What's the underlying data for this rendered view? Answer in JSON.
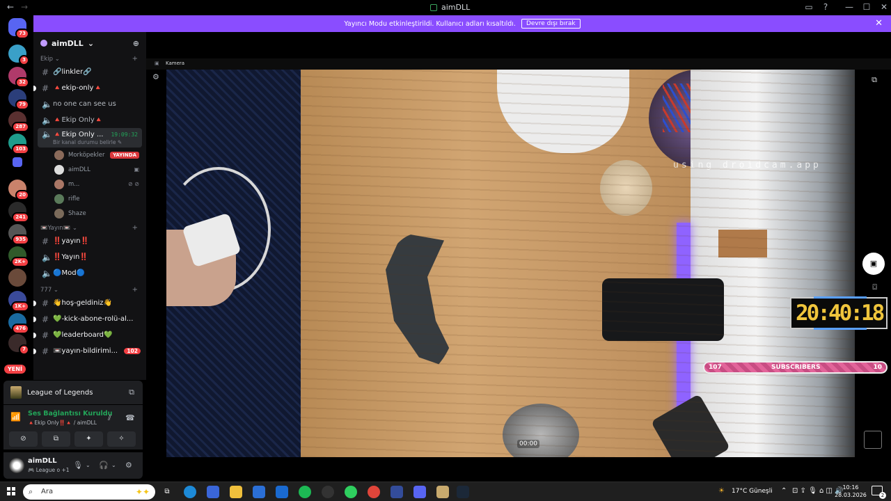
{
  "window": {
    "title": "aimDLL",
    "nav_back": "←",
    "nav_forward": "→",
    "controls": [
      "▭",
      "?",
      "—",
      "☐",
      "✕"
    ]
  },
  "notice": {
    "text": "Yayıncı Modu etkinleştirildi. Kullanıcı adları kısaltıldı.",
    "button": "Devre dışı bırak",
    "close": "✕"
  },
  "rail": {
    "home_badge": "73",
    "servers": [
      {
        "badge": "3",
        "color": "#3aa0c8"
      },
      {
        "badge": "32",
        "color": "#b03a6a"
      },
      {
        "badge": "79",
        "color": "#2b3e7a"
      },
      {
        "badge": "287",
        "color": "#5a3030"
      },
      {
        "badge": "103",
        "color": "#1f9c8c"
      },
      {
        "badge": "",
        "color": "#5865f2"
      },
      {
        "badge": "20",
        "color": "#c9826b"
      },
      {
        "badge": "241",
        "color": "#2a2a2a"
      },
      {
        "badge": "935",
        "color": "#555555"
      },
      {
        "badge": "2K+",
        "color": "#2f5a2a"
      },
      {
        "badge": "",
        "color": "#6a4a3a"
      },
      {
        "badge": "1K+",
        "color": "#3a4a9a"
      },
      {
        "badge": "476",
        "color": "#1a6aa0"
      },
      {
        "badge": "7",
        "color": "#3a2a2a"
      }
    ],
    "new_label": "YENİ"
  },
  "sidebar": {
    "server_name": "aimDLL",
    "add_member_icon": "⊕",
    "categories": [
      {
        "name": "Ekip",
        "channels": [
          {
            "type": "text",
            "name": "🔗linkler🔗"
          },
          {
            "type": "text",
            "name": "🔺ekip-only🔺"
          },
          {
            "type": "voice",
            "name": "no one can see us"
          },
          {
            "type": "voice",
            "name": "🔺Ekip Only🔺"
          }
        ]
      }
    ],
    "active_channel": {
      "name": "🔺Ekip Only ...",
      "time": "19:09:32",
      "status": "Bir kanal durumu belirle ✎"
    },
    "members": [
      {
        "name": "Morköpekler",
        "live": "YAYINDA",
        "color": "#8a6a5a"
      },
      {
        "name": "aimDLL",
        "icon": "▣",
        "color": "#dddddd"
      },
      {
        "name": "m...",
        "icon": "⊘ ⊘",
        "color": "#aa7766"
      },
      {
        "name": "rifle",
        "color": "#5a7a5a"
      },
      {
        "name": "Shaze",
        "color": "#7a6a5a"
      }
    ],
    "category2": {
      "name": "📼Yayın📼",
      "channels": [
        {
          "type": "text",
          "name": "‼️yayın‼️"
        },
        {
          "type": "voice",
          "name": "‼️Yayın‼️"
        },
        {
          "type": "voice",
          "name": "🔵Mod🔵"
        }
      ]
    },
    "category3": {
      "name": "777",
      "channels": [
        {
          "type": "text",
          "name": "👋hoş-geldiniz👋"
        },
        {
          "type": "text",
          "name": "💚-kick-abone-rolü-al..."
        },
        {
          "type": "text",
          "name": "💚leaderboard💚"
        },
        {
          "type": "text",
          "name": "📼yayın-bildirimi...",
          "badge": "102"
        }
      ]
    }
  },
  "game_panel": {
    "name": "League of Legends"
  },
  "voice_panel": {
    "status": "Ses Bağlantısı Kuruldu",
    "location": "🔺Ekip Only‼️🔺 / aimDLL"
  },
  "user_panel": {
    "name": "aimDLL",
    "status": "🎮 League o +1"
  },
  "stream": {
    "camera_title": "Kamera",
    "watermark": "using droidcam.app",
    "video_time": "00:00",
    "overlay_clock": "20:40:18",
    "subs_left": "107",
    "subs_label": "SUBSCRIBERS",
    "subs_right": "10"
  },
  "taskbar": {
    "search_placeholder": "Ara",
    "weather": "17°C  Güneşli",
    "time": "10:16",
    "date": "28.03.2026"
  },
  "colors": {
    "accent": "#8a4dff",
    "online": "#23a559",
    "danger": "#f23f43"
  }
}
